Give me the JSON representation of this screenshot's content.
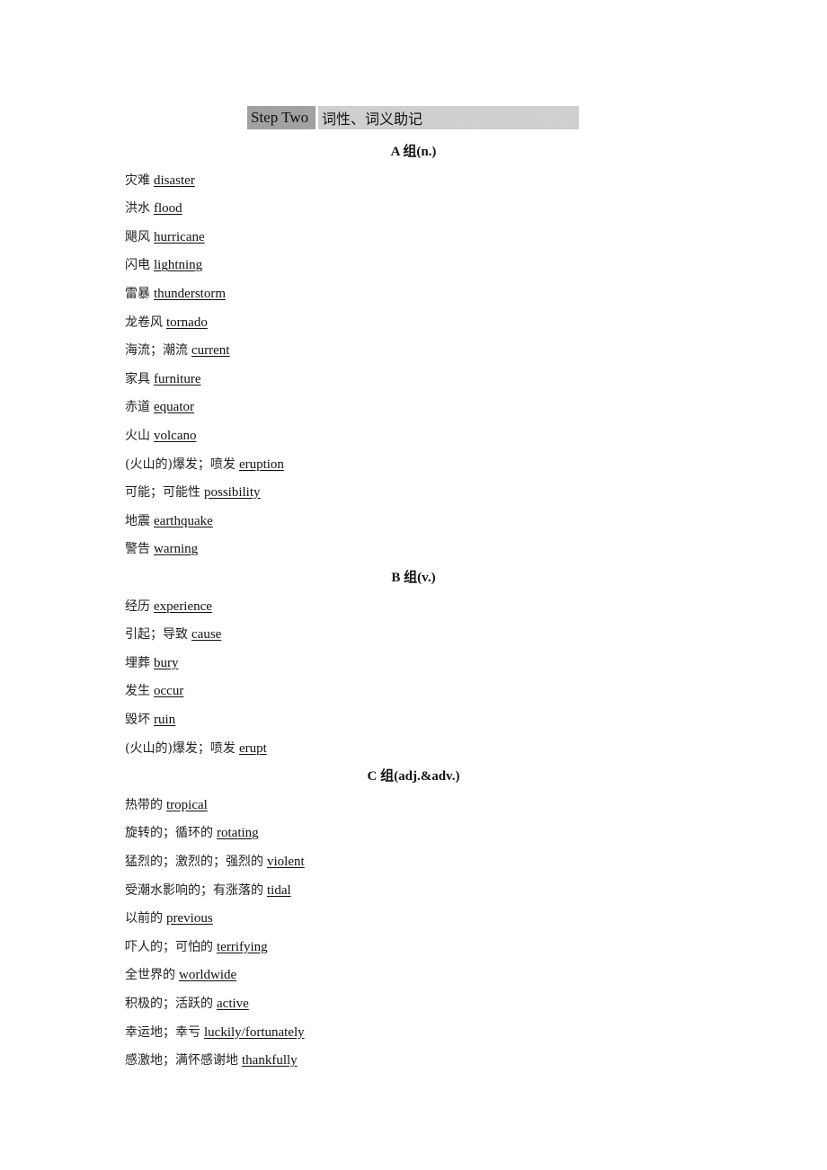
{
  "header": {
    "step_label": "Step Two",
    "title": "词性、词义助记"
  },
  "groups": [
    {
      "title": "A 组(n.)",
      "entries": [
        {
          "cn": "灾难",
          "en": "disaster"
        },
        {
          "cn": "洪水",
          "en": "flood"
        },
        {
          "cn": "飓风",
          "en": "hurricane"
        },
        {
          "cn": "闪电",
          "en": "lightning"
        },
        {
          "cn": "雷暴",
          "en": "thunderstorm"
        },
        {
          "cn": "龙卷风",
          "en": "tornado"
        },
        {
          "cn": "海流；潮流",
          "en": "current"
        },
        {
          "cn": "家具",
          "en": "furniture"
        },
        {
          "cn": "赤道",
          "en": "equator"
        },
        {
          "cn": "火山",
          "en": "volcano"
        },
        {
          "cn": "(火山的)爆发；喷发",
          "en": "eruption"
        },
        {
          "cn": "可能；可能性",
          "en": "possibility"
        },
        {
          "cn": "地震",
          "en": "earthquake"
        },
        {
          "cn": "警告",
          "en": "warning"
        }
      ]
    },
    {
      "title": "B 组(v.)",
      "entries": [
        {
          "cn": "经历",
          "en": "experience"
        },
        {
          "cn": "引起；导致",
          "en": "cause"
        },
        {
          "cn": "埋葬",
          "en": "bury"
        },
        {
          "cn": "发生",
          "en": "occur"
        },
        {
          "cn": "毁坏",
          "en": "ruin"
        },
        {
          "cn": "(火山的)爆发；喷发",
          "en": "erupt"
        }
      ]
    },
    {
      "title": "C 组(adj.&adv.)",
      "entries": [
        {
          "cn": "热带的",
          "en": "tropical"
        },
        {
          "cn": "旋转的；循环的",
          "en": "rotating"
        },
        {
          "cn": "猛烈的；激烈的；强烈的",
          "en": "violent"
        },
        {
          "cn": "受潮水影响的；有涨落的",
          "en": "tidal"
        },
        {
          "cn": "以前的",
          "en": "previous"
        },
        {
          "cn": "吓人的；可怕的",
          "en": "terrifying"
        },
        {
          "cn": "全世界的",
          "en": "worldwide"
        },
        {
          "cn": "积极的；活跃的",
          "en": "active"
        },
        {
          "cn": "幸运地；幸亏",
          "en": "luckily/fortunately"
        },
        {
          "cn": "感激地；满怀感谢地",
          "en": "thankfully"
        }
      ]
    }
  ]
}
